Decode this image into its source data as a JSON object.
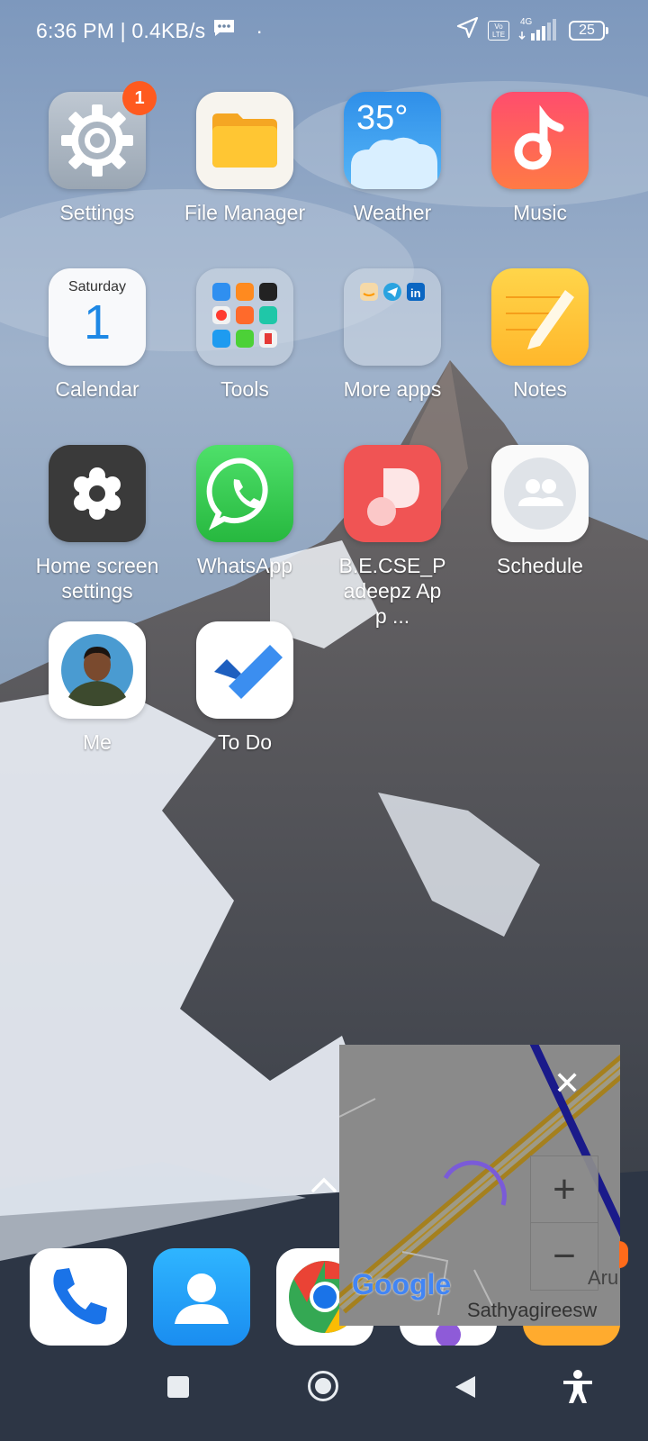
{
  "status_bar": {
    "time_speed": "6:36 PM | 0.4KB/s",
    "dot": "·",
    "volte": "Vo LTE",
    "network": "4G",
    "battery": "25"
  },
  "apps": [
    {
      "name": "Settings",
      "badge": "1"
    },
    {
      "name": "File Manager"
    },
    {
      "name": "Weather",
      "temp": "35°"
    },
    {
      "name": "Music"
    },
    {
      "name": "Calendar",
      "day": "Saturday",
      "date": "1"
    },
    {
      "name": "Tools"
    },
    {
      "name": "More apps"
    },
    {
      "name": "Notes"
    },
    {
      "name": "Home screen settings"
    },
    {
      "name": "WhatsApp"
    },
    {
      "name": "B.E.CSE_Padeepz App ..."
    },
    {
      "name": "Schedule"
    },
    {
      "name": "Me"
    },
    {
      "name": "To Do"
    }
  ],
  "dock": [
    "phone-icon",
    "contacts-icon",
    "chrome-icon",
    "messages-icon",
    "gallery-icon"
  ],
  "map_widget": {
    "logo": "Google",
    "place_label": "Sathyagireesw",
    "place_label_2": "Aru",
    "zoom_in": "+",
    "zoom_out": "−",
    "close": "✕"
  },
  "colors": {
    "badge": "#ff5a1f",
    "whatsapp": "#33cc4a",
    "music": "#ff5a6c",
    "weather": "#3ba6f2",
    "notes": "#ffcc3d"
  }
}
